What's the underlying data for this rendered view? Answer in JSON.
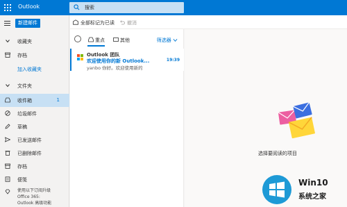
{
  "topbar": {
    "app_title": "Outlook",
    "search_placeholder": "搜索"
  },
  "nav": {
    "new_mail_label": "新建邮件",
    "favorites_header": "收藏夹",
    "favorites_item": "存档",
    "add_favorite_link": "加入收藏夹",
    "folders_header": "文件夹",
    "folders": [
      {
        "label": "收件箱",
        "count": "1",
        "icon": "inbox-icon",
        "selected": true
      },
      {
        "label": "垃圾邮件",
        "count": "",
        "icon": "junk-icon"
      },
      {
        "label": "草稿",
        "count": "",
        "icon": "pencil-icon"
      },
      {
        "label": "已发送邮件",
        "count": "",
        "icon": "send-icon"
      },
      {
        "label": "已删除邮件",
        "count": "",
        "icon": "trash-icon"
      },
      {
        "label": "存档",
        "count": "",
        "icon": "archive-icon"
      },
      {
        "label": "便笺",
        "count": "",
        "icon": "note-icon"
      }
    ],
    "footer_lines": [
      "使用以下订阅升级",
      "Office 365:",
      "Outlook 高级功能"
    ]
  },
  "cmdbar": {
    "mark_all_read": "全部标记为已读",
    "undo": "撤消"
  },
  "list": {
    "tab_focused": "重点",
    "tab_other": "其他",
    "filter_label": "筛选器",
    "messages": [
      {
        "sender": "Outlook 团队",
        "subject": "欢迎使用你的新 Outlook...",
        "time": "19:39",
        "preview": "yanbo 你好。欢迎使用新的"
      }
    ]
  },
  "reading": {
    "empty_text": "选择要阅读的项目"
  },
  "watermark": {
    "line1": "Win10",
    "line2": "系统之家"
  },
  "colors": {
    "accent": "#0078d4",
    "selected_bg": "#c7e0f4"
  }
}
